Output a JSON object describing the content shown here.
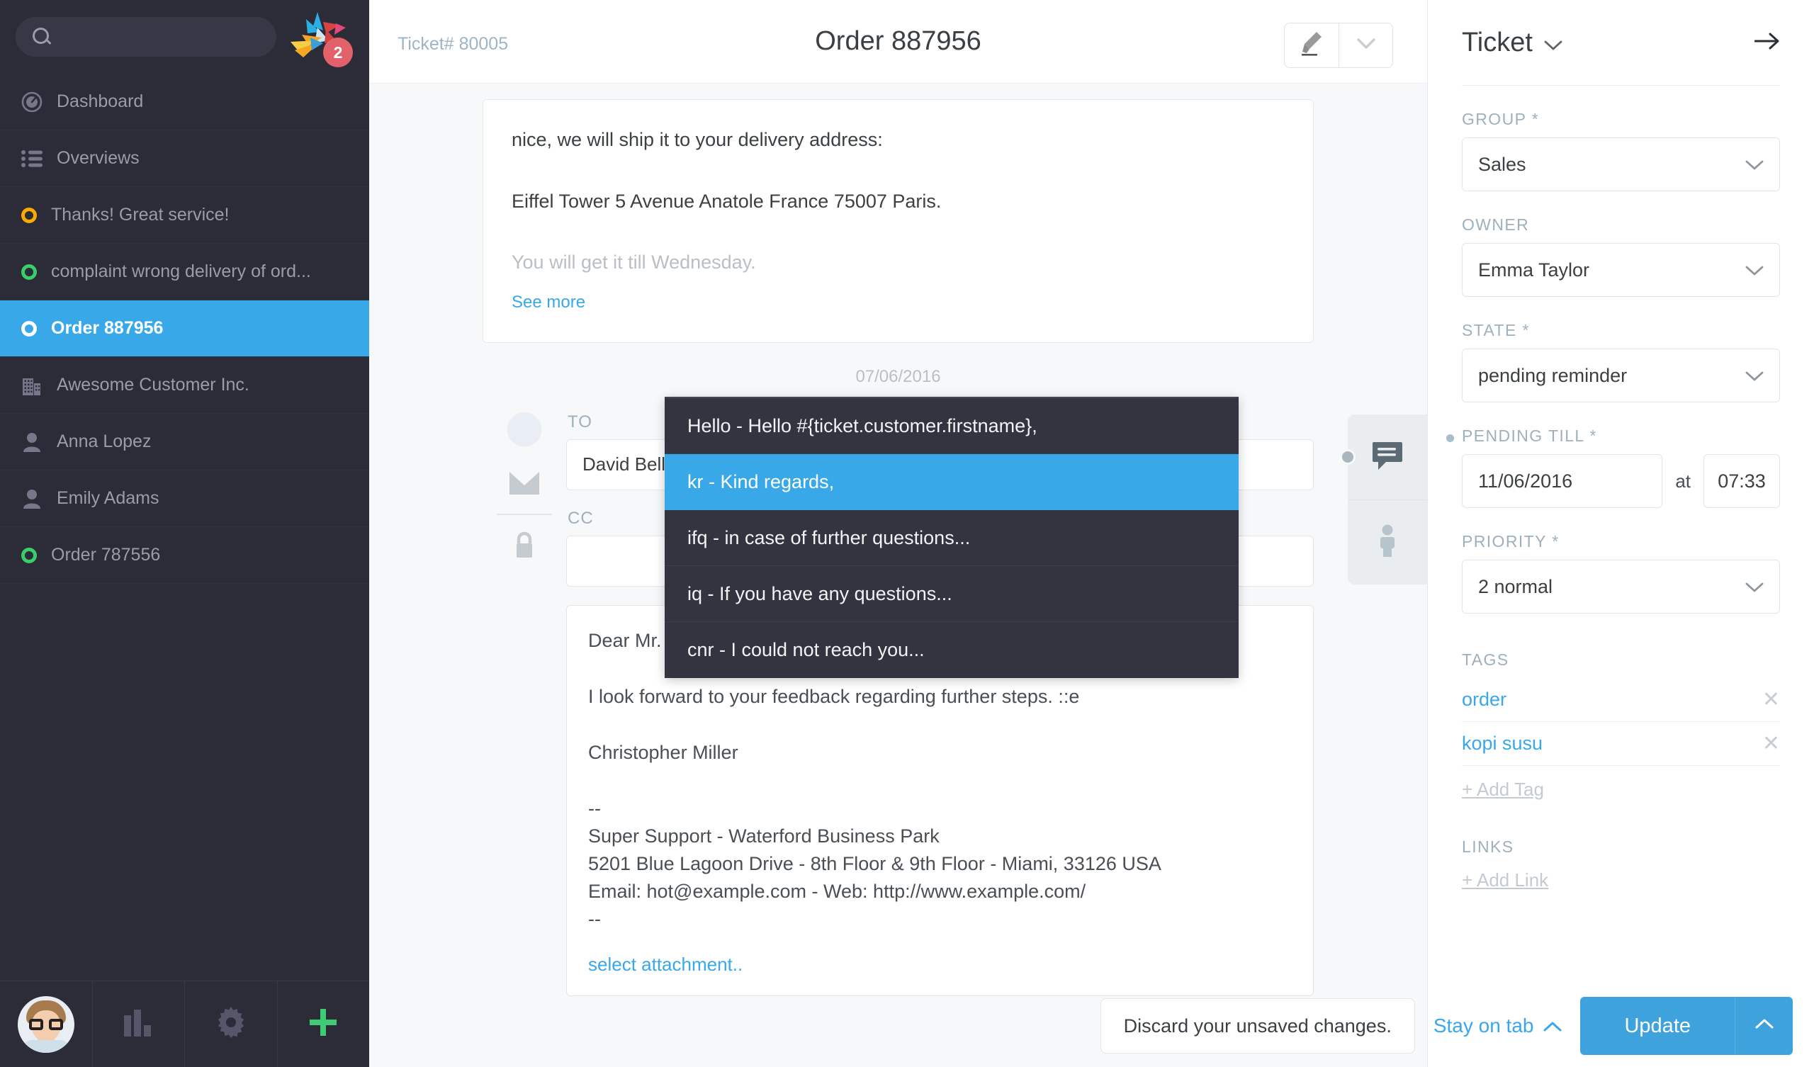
{
  "app": {
    "brand_accent": "#38a8e8",
    "sidebar_bg": "#2b2c37",
    "notification_count": "2"
  },
  "search": {
    "value": "",
    "placeholder": ""
  },
  "sidebar": {
    "items": [
      {
        "label": "Dashboard",
        "icon": "dashboard-icon",
        "kind": "icon",
        "state": "",
        "active": false
      },
      {
        "label": "Overviews",
        "icon": "list-icon",
        "kind": "icon",
        "state": "",
        "active": false
      },
      {
        "label": "Thanks! Great service!",
        "icon": "state-dot",
        "kind": "dot",
        "state": "yellow",
        "active": false
      },
      {
        "label": "complaint wrong delivery of ord...",
        "icon": "state-dot",
        "kind": "dot",
        "state": "green",
        "active": false
      },
      {
        "label": "Order 887956",
        "icon": "state-dot",
        "kind": "dot",
        "state": "white",
        "active": true
      },
      {
        "label": "Awesome Customer Inc.",
        "icon": "building-icon",
        "kind": "icon",
        "state": "",
        "active": false
      },
      {
        "label": "Anna Lopez",
        "icon": "person-icon",
        "kind": "icon",
        "state": "",
        "active": false
      },
      {
        "label": "Emily Adams",
        "icon": "person-icon",
        "kind": "icon",
        "state": "",
        "active": false
      },
      {
        "label": "Order 787556",
        "icon": "state-dot",
        "kind": "dot",
        "state": "green",
        "active": false
      }
    ],
    "bottom": [
      {
        "name": "user-avatar",
        "icon": "avatar-photo"
      },
      {
        "name": "reports-button",
        "icon": "bar-chart-icon"
      },
      {
        "name": "settings-button",
        "icon": "gear-icon"
      },
      {
        "name": "new-button",
        "icon": "plus-icon"
      }
    ]
  },
  "header": {
    "ticket_number": "Ticket# 80005",
    "title": "Order 887956",
    "highlight_icon": "marker-pen-icon",
    "caret_icon": "chevron-down-icon"
  },
  "article": {
    "line1": "nice, we will ship it to your delivery address:",
    "line2": "Eiffel Tower 5 Avenue Anatole France 75007 Paris.",
    "line3": "You will get it till Wednesday.",
    "see_more": "See more",
    "date_divider": "07/06/2016"
  },
  "compose": {
    "to_label": "TO",
    "to_value": "David Bell <david@",
    "cc_label": "CC",
    "cc_value": "",
    "body": {
      "greeting": "Dear Mr. Bell,",
      "paragraph": "I look forward to your feedback regarding further steps. ::e",
      "signer": "Christopher Miller",
      "sep_top": "--",
      "sig_line1": "Super Support - Waterford Business Park",
      "sig_line2": "5201 Blue Lagoon Drive - 8th Floor & 9th Floor - Miami, 33126 USA",
      "sig_line3": "Email: hot@example.com - Web: http://www.example.com/",
      "sep_bottom": "--"
    },
    "attachment_link": "select attachment..",
    "rail_icons": [
      "avatar-photo",
      "mail-icon",
      "lock-icon"
    ]
  },
  "text_modules": {
    "items": [
      {
        "label": "Hello - Hello #{ticket.customer.firstname},",
        "selected": false
      },
      {
        "label": "kr - Kind regards,",
        "selected": true
      },
      {
        "label": "ifq - in case of further questions...",
        "selected": false
      },
      {
        "label": "iq - If you have any questions...",
        "selected": false
      },
      {
        "label": "cnr - I could not reach you...",
        "selected": false
      }
    ]
  },
  "tab_rail": {
    "items": [
      {
        "name": "ticket-tab",
        "icon": "speech-bubble-icon"
      },
      {
        "name": "customer-tab",
        "icon": "person-icon"
      }
    ]
  },
  "right_sidebar": {
    "title": "Ticket",
    "title_caret": "chevron-down-icon",
    "collapse_icon": "arrow-right-icon",
    "fields": [
      {
        "label": "GROUP *",
        "value": "Sales",
        "type": "select"
      },
      {
        "label": "OWNER",
        "value": "Emma Taylor",
        "type": "select"
      },
      {
        "label": "STATE *",
        "value": "pending reminder",
        "type": "select"
      }
    ],
    "pending_till": {
      "label": "PENDING TILL *",
      "date": "11/06/2016",
      "at": "at",
      "time": "07:33"
    },
    "priority": {
      "label": "PRIORITY *",
      "value": "2 normal"
    },
    "tags": {
      "label": "TAGS",
      "items": [
        "order",
        "kopi susu"
      ],
      "remove_icon": "close-icon",
      "add": "+ Add Tag"
    },
    "links": {
      "label": "LINKS",
      "add": "+ Add Link"
    }
  },
  "action_bar": {
    "discard": "Discard your unsaved changes.",
    "stay_on_tab": "Stay on tab",
    "stay_caret": "chevron-up-icon",
    "update": "Update",
    "update_caret": "chevron-up-icon"
  }
}
